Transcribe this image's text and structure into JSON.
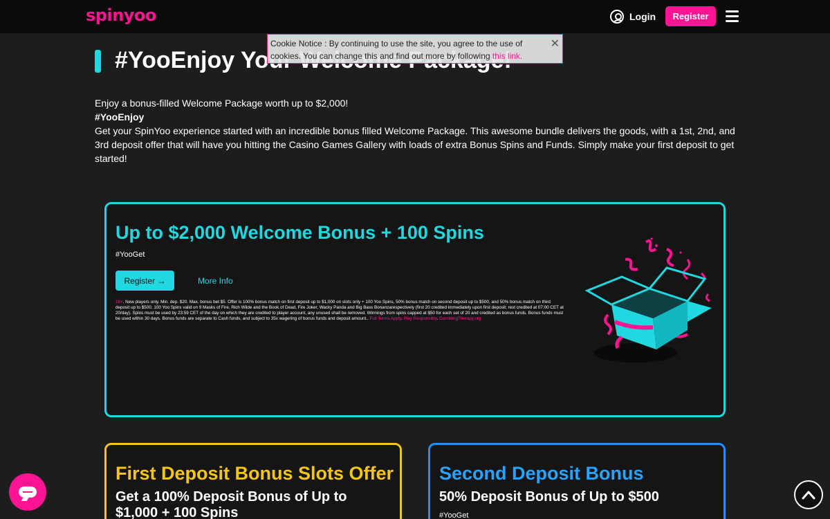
{
  "header": {
    "logo_text": "spinyoo",
    "login_label": "Login",
    "register_label": "Register"
  },
  "page": {
    "title": "#YooEnjoy Your Welcome Package!"
  },
  "cookie": {
    "text": "Cookie Notice : By continuing to use the site, you agree to the use of cookies. You can change this and find out more by following ",
    "link_text": "this link.",
    "close_symbol": "✕"
  },
  "intro": {
    "line1": "Enjoy a bonus-filled Welcome Package worth up to $2,000!",
    "hashtag": "#YooEnjoy",
    "paragraph": "Get your SpinYoo experience started with an incredible bonus filled Welcome Package. This awesome bundle delivers the goods, with a 1st, 2nd, and 3rd deposit offer that will have you hitting the Casino Games Gallery with loads of extra Bonus Spins and Funds. Simply make your first deposit to get started!"
  },
  "welcome_card": {
    "title": "Up to $2,000 Welcome Bonus + 100 Spins",
    "tag": "#YooGet",
    "register_label": "Register →",
    "more_info_label": "More Info",
    "terms_age": "18+",
    "terms_text": ". New players only. Min. dep. $20. Max. bonus bet $5. Offer is 100% bonus match on first deposit up to $1,000 on slots only + 100 Yoo Spins, 50% bonus match on second deposit up to $500, and 50% bonus match on third deposit up to $500. 100 Yoo Spins valid on 9 Masks of Fire, Rich Wilde and the Book of Dead, Fire Joker, Wacky Panda and Big Bass Bonanzarespectively (first 20 credited immediately upon first deposit; rest credited at 07:00 CET at 20/day). Spins must be used by 23:59 CET of the day on which they are credited to player account, any unused shall be removed. Winnings from spins capped at $50 for each set of 20 and credited as bonus funds. Bonus funds must be used within 30 days. Bonus funds are separate to Cash funds, and subject to 35x wagering of bonus funds and deposit amount.. ",
    "terms_link1": "Full Terms Apply",
    "terms_sep": ". ",
    "terms_link2": "Play Responsibly",
    "terms_link3": "GamblingTherapy.org"
  },
  "cards": [
    {
      "title": "First Deposit Bonus Slots Offer",
      "subtitle": "Get a 100% Deposit Bonus of Up to $1,000 + 100 Spins",
      "tag": ""
    },
    {
      "title": "Second Deposit Bonus",
      "subtitle": "50% Deposit Bonus of Up to $500",
      "tag": "#YooGet"
    }
  ],
  "icons": {
    "user": "user-icon",
    "menu": "hamburger-icon",
    "chat": "chat-icon",
    "scroll_top": "chevron-up-icon",
    "gift": "gift-box-icon"
  },
  "colors": {
    "brand_pink": "#ff1493",
    "accent_cyan": "#1fd8e0",
    "accent_yellow": "#f5c518",
    "accent_blue": "#2aa3ff",
    "background": "#1d1d1d"
  }
}
